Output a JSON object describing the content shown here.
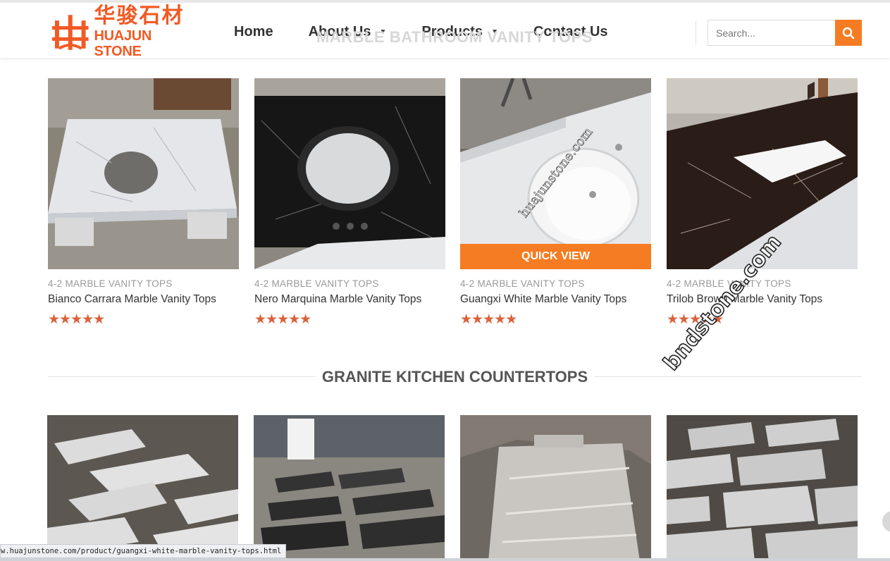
{
  "header": {
    "logo_cn": "华骏石材",
    "logo_en": "HUAJUN STONE",
    "behind_title": "MARBLE BATHROOM VANITY TOPS",
    "nav": [
      {
        "label": "Home",
        "dropdown": false
      },
      {
        "label": "About Us",
        "dropdown": true
      },
      {
        "label": "Products",
        "dropdown": true
      },
      {
        "label": "Contact Us",
        "dropdown": false
      }
    ],
    "search_placeholder": "Search...",
    "accent": "#f57c22",
    "logo_color": "#f15a24"
  },
  "products": [
    {
      "category": "4-2 MARBLE VANITY TOPS",
      "name": "Bianco Carrara Marble Vanity Tops",
      "stars": "★★★★★",
      "rating": 5
    },
    {
      "category": "4-2 MARBLE VANITY TOPS",
      "name": "Nero Marquina Marble Vanity Tops",
      "stars": "★★★★★",
      "rating": 5
    },
    {
      "category": "4-2 MARBLE VANITY TOPS",
      "name": "Guangxi White Marble Vanity Tops",
      "stars": "★★★★★",
      "rating": 5,
      "quick_view": "QUICK VIEW",
      "image_watermark": "huajunstone.com"
    },
    {
      "category": "4-2 MARBLE VANITY TOPS",
      "name": "Trilob Brown Marble Vanity Tops",
      "stars": "★★★★★",
      "rating": 5
    }
  ],
  "section2": {
    "title": "GRANITE KITCHEN COUNTERTOPS"
  },
  "overlay_watermark": "bndstone.com",
  "status_url": "w.huajunstone.com/product/guangxi-white-marble-vanity-tops.html",
  "star_color": "#d9623b"
}
